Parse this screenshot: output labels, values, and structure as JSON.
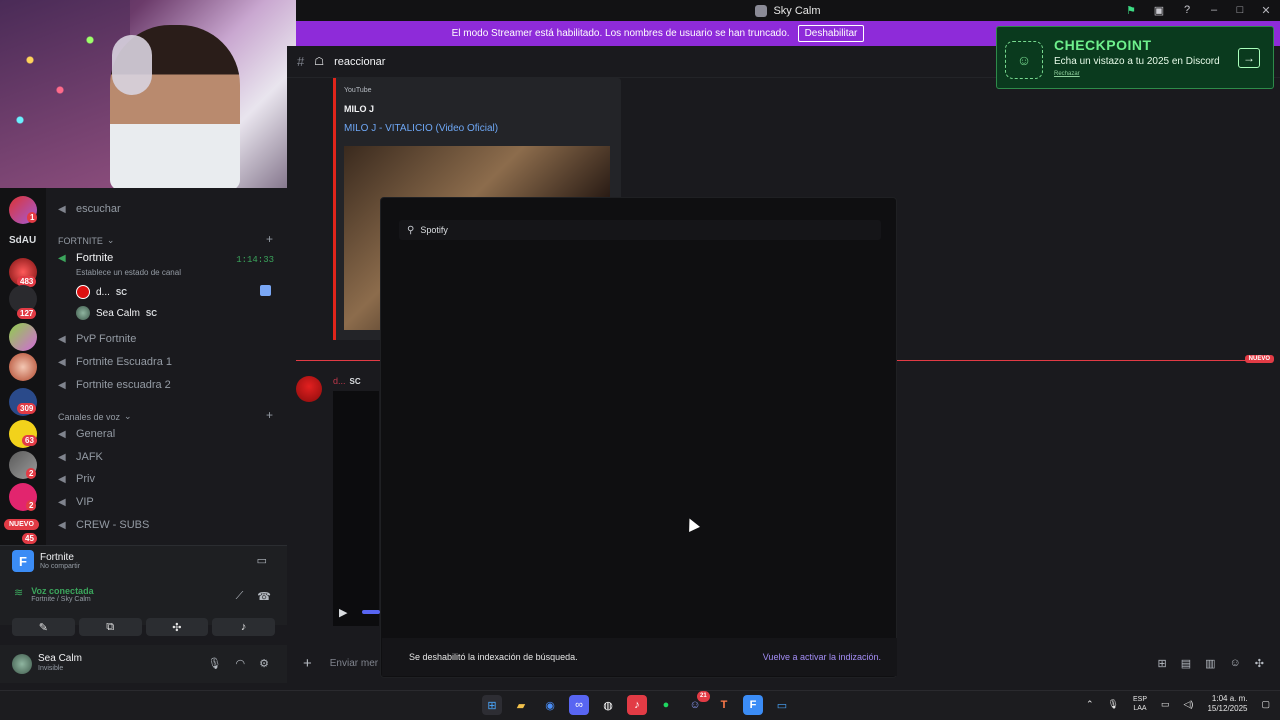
{
  "window": {
    "title": "Sky Calm"
  },
  "streamer_banner": {
    "text": "El modo Streamer está habilitado. Los nombres de usuario se han truncado.",
    "button": "Deshabilitar"
  },
  "servers": {
    "label": "SdAU",
    "badges": [
      "1",
      "483",
      "127",
      "309",
      "63",
      "2",
      "2",
      "45"
    ],
    "nuevo": "NUEVO"
  },
  "channels": {
    "top_channel": "escuchar",
    "category_fortnite": "FORTNITE",
    "active_channel": "Fortnite",
    "active_timer": "1:14:33",
    "active_status": "Establece un estado de canal",
    "voice_users": [
      {
        "name": "d...",
        "tag": "SC"
      },
      {
        "name": "Sea Calm",
        "tag": "SC"
      }
    ],
    "fortnite_channels": [
      "PvP Fortnite",
      "Fortnite Escuadra 1",
      "Fortnite escuadra 2"
    ],
    "category_voice": "Canales de voz",
    "voice_channels": [
      "General",
      "JAFK",
      "Priv",
      "VIP",
      "CREW - SUBS"
    ]
  },
  "activity": {
    "game_icon": "F",
    "game": "Fortnite",
    "game_sub": "No compartir",
    "voice_title": "Voz conectada",
    "voice_sub": "Fortnite / Sky Calm"
  },
  "user": {
    "name": "Sea Calm",
    "status": "Invisible"
  },
  "chat": {
    "channel": "reaccionar",
    "embed": {
      "provider": "YouTube",
      "author": "MILO J",
      "title": "MILO J - VITALICIO (Video Oficial)"
    },
    "new_label": "NUEVO",
    "message_author": "d...",
    "message_tag": "SC",
    "composer_placeholder": "Enviar mer"
  },
  "checkpoint": {
    "title": "CHECKPOINT",
    "subtitle": "Echa un vistazo a tu 2025 en Discord",
    "dismiss": "Rechazar"
  },
  "search_modal": {
    "query": "Spotify",
    "footer_text": "Se deshabilitó la indexación de búsqueda.",
    "footer_link": "Vuelve a activar la indización."
  },
  "taskbar": {
    "lang_top": "ESP",
    "lang_bottom": "LAA",
    "time": "1:04 a. m.",
    "date": "15/12/2025",
    "discord_badge": "21"
  },
  "colors": {
    "streamer_purple": "#8e2bd9",
    "checkpoint_green": "#6ef08c",
    "new_red": "#e23b45",
    "voice_green": "#3ba55c",
    "link_blue": "#6ea7f5"
  }
}
